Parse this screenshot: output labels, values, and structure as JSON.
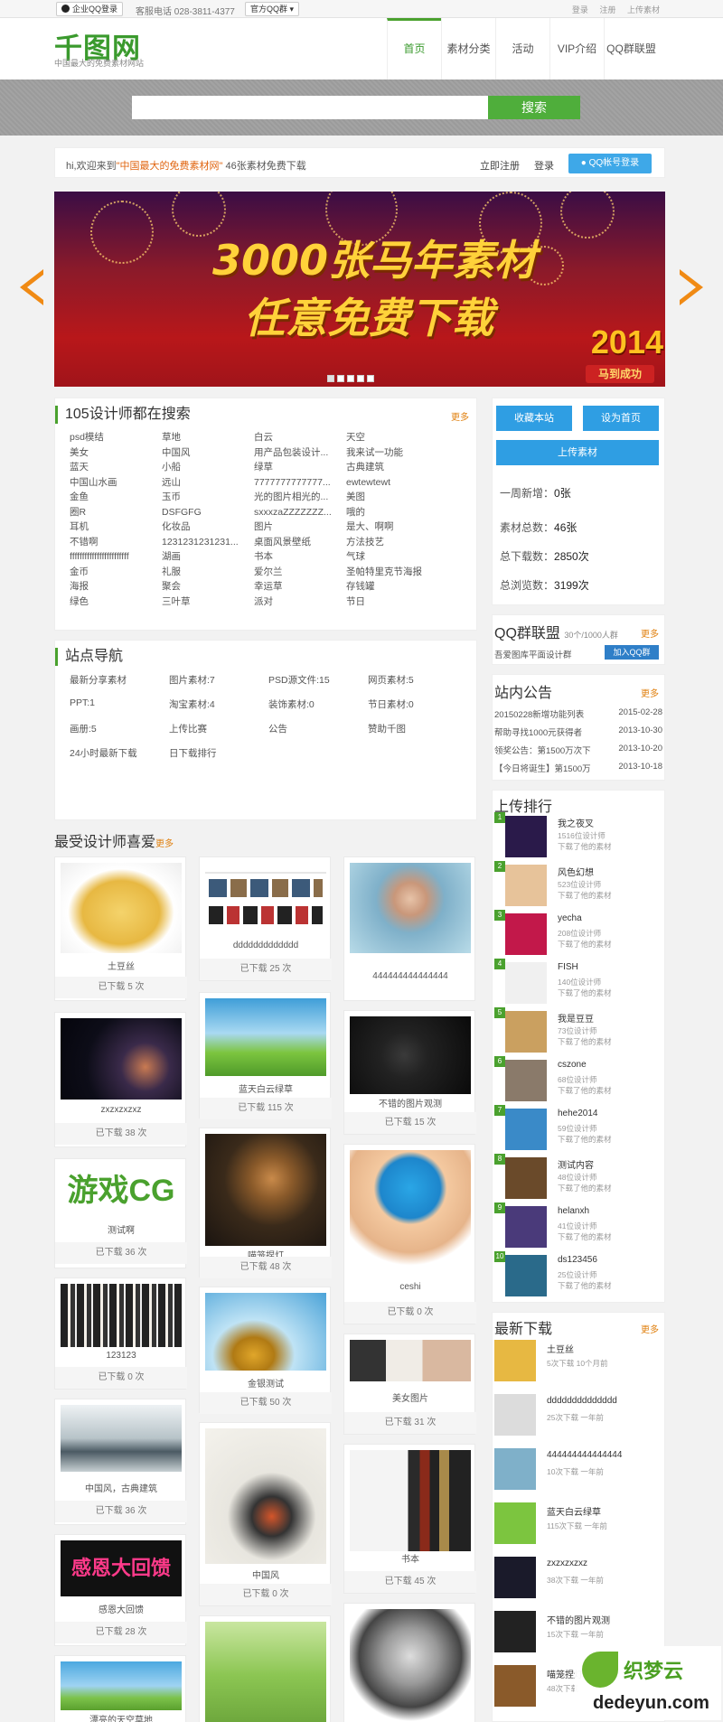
{
  "topbar": {
    "qq_login": "企业QQ登录",
    "phone": "客服电话 028-3811-4377",
    "qq_group": "官方QQ群",
    "links": [
      "登录",
      "注册",
      "上传素材"
    ]
  },
  "header": {
    "logo": "千图网",
    "slogan": "中国最大的免费素材网站",
    "nav": [
      "首页",
      "素材分类",
      "活动",
      "VIP介绍",
      "QQ群联盟"
    ]
  },
  "search": {
    "placeholder": "",
    "button": "搜索"
  },
  "welcome": {
    "prefix": "hi,欢迎来到",
    "site": "\"中国最大的免费素材网\"",
    "suffix": "46张素材免费下载",
    "register": "立即注册",
    "login": "登录",
    "qq_login": "QQ帐号登录"
  },
  "banner": {
    "line1": "3000张马年素材",
    "line2": "任意免费下载",
    "year": "2014",
    "tag": "马到成功",
    "slides": 5
  },
  "hot_search": {
    "title": "105设计师都在搜索",
    "more": "更多",
    "keywords": [
      "psd模结",
      "草地",
      "白云",
      "天空",
      "美女",
      "中国风",
      "用产品包装设计...",
      "我来试一功能",
      "蓝天",
      "小船",
      "绿草",
      "古典建筑",
      "中国山水画",
      "远山",
      "7777777777777...",
      "ewtewtewt",
      "金鱼",
      "玉币",
      "光的图片相光的...",
      "美图",
      "圈R",
      "DSFGFG",
      "sxxxzaZZZZZZZ...",
      "哦的",
      "耳机",
      "化妆品",
      "图片",
      "是大、啊啊",
      "不错啊",
      "1231231231231...",
      "桌面风景壁纸",
      "方法技艺",
      "ffffffffffffffffffffffff",
      "湖画",
      "书本",
      "气球",
      "金币",
      "礼服",
      "爱尔兰",
      "圣帕特里克节海报",
      "海报",
      "聚会",
      "幸运草",
      "存钱罐",
      "绿色",
      "三叶草",
      "派对",
      "节日"
    ]
  },
  "site_nav": {
    "title": "站点导航",
    "links": [
      "最新分享素材",
      "图片素材:7",
      "PSD源文件:15",
      "网页素材:5",
      "PPT:1",
      "淘宝素材:4",
      "装饰素材:0",
      "节日素材:0",
      "画册:5",
      "上传比赛",
      "公告",
      "赞助千图",
      "24小时最新下载",
      "日下载排行"
    ]
  },
  "favorites": {
    "title": "最受设计师喜爱",
    "more": "更多",
    "columns": [
      [
        {
          "title": "土豆丝",
          "dl": "已下载 5 次"
        },
        {
          "title": "zxzxzxzxz",
          "dl": "已下载 38 次"
        },
        {
          "title": "测试啊",
          "dl": "已下载 36 次",
          "logo": "游戏CG"
        },
        {
          "title": "123123",
          "dl": "已下载 0 次"
        },
        {
          "title": "中国风，古典建筑",
          "dl": "已下载 36 次"
        },
        {
          "title": "感恩大回馈",
          "dl": "已下载 28 次",
          "logo": "感恩大回馈"
        },
        {
          "title": "漂亮的天空草地",
          "dl": ""
        }
      ],
      [
        {
          "title": "ddddddddddddd",
          "dl": "已下载 25 次"
        },
        {
          "title": "蓝天白云绿草",
          "dl": "已下载 115 次"
        },
        {
          "title": "喵笼捏灯",
          "dl": "已下载 48 次"
        },
        {
          "title": "金银测试",
          "dl": "已下载 50 次"
        },
        {
          "title": "中国风",
          "dl": "已下载 0 次"
        },
        {
          "title": "",
          "dl": ""
        }
      ],
      [
        {
          "title": "444444444444444",
          "dl": "已下载 10 次"
        },
        {
          "title": "不错的图片观测",
          "dl": "已下载 15 次"
        },
        {
          "title": "ceshi",
          "dl": "已下载 0 次"
        },
        {
          "title": "美女图片",
          "dl": "已下载 31 次"
        },
        {
          "title": "书本",
          "dl": "已下载 45 次"
        },
        {
          "title": "",
          "dl": ""
        }
      ]
    ]
  },
  "sidebar": {
    "fav_site": "收藏本站",
    "set_home": "设为首页",
    "upload": "上传素材",
    "stats": [
      {
        "label": "一周新增：",
        "value": "0张"
      },
      {
        "label": "素材总数：",
        "value": "46张"
      },
      {
        "label": "总下载数：",
        "value": "2850次"
      },
      {
        "label": "总浏览数：",
        "value": "3199次"
      }
    ],
    "qq_union": {
      "title": "QQ群联盟",
      "sub": "30个/1000人群",
      "more": "更多",
      "group": "吾爱图库平面设计群",
      "join": "加入QQ群"
    },
    "notices": {
      "title": "站内公告",
      "more": "更多",
      "items": [
        {
          "text": "20150228新增功能列表",
          "date": "2015-02-28"
        },
        {
          "text": "帮助寻找1000元获得者",
          "date": "2013-10-30"
        },
        {
          "text": "领奖公告：第1500万次下",
          "date": "2013-10-20"
        },
        {
          "text": "【今日将诞生】第1500万",
          "date": "2013-10-18"
        }
      ]
    },
    "upload_rank": {
      "title": "上传排行",
      "items": [
        {
          "no": "1",
          "name": "我之夜叉",
          "count": "1516位设计师",
          "sub": "下载了他的素材"
        },
        {
          "no": "2",
          "name": "风色幻想",
          "count": "523位设计师",
          "sub": "下载了他的素材"
        },
        {
          "no": "3",
          "name": "yecha",
          "count": "208位设计师",
          "sub": "下载了他的素材"
        },
        {
          "no": "4",
          "name": "FISH",
          "count": "140位设计师",
          "sub": "下载了他的素材"
        },
        {
          "no": "5",
          "name": "我是豆豆",
          "count": "73位设计师",
          "sub": "下载了他的素材"
        },
        {
          "no": "6",
          "name": "cszone",
          "count": "68位设计师",
          "sub": "下载了他的素材"
        },
        {
          "no": "7",
          "name": "hehe2014",
          "count": "59位设计师",
          "sub": "下载了他的素材"
        },
        {
          "no": "8",
          "name": "测试内容",
          "count": "48位设计师",
          "sub": "下载了他的素材"
        },
        {
          "no": "9",
          "name": "helanxh",
          "count": "41位设计师",
          "sub": "下载了他的素材"
        },
        {
          "no": "10",
          "name": "ds123456",
          "count": "25位设计师",
          "sub": "下载了他的素材"
        }
      ]
    },
    "latest": {
      "title": "最新下载",
      "more": "更多",
      "items": [
        {
          "name": "土豆丝",
          "sub": "5次下载  10个月前"
        },
        {
          "name": "dddddddddddddd",
          "sub": "25次下载  一年前"
        },
        {
          "name": "444444444444444",
          "sub": "10次下载  一年前"
        },
        {
          "name": "蓝天白云绿草",
          "sub": "115次下载  一年前"
        },
        {
          "name": "zxzxzxzxz",
          "sub": "38次下载  一年前"
        },
        {
          "name": "不错的图片观测",
          "sub": "15次下载  一年前"
        },
        {
          "name": "喵笼捏灯",
          "sub": "48次下载"
        }
      ]
    }
  },
  "watermark": {
    "brand": "织梦云",
    "site": "dedeyun.com"
  }
}
